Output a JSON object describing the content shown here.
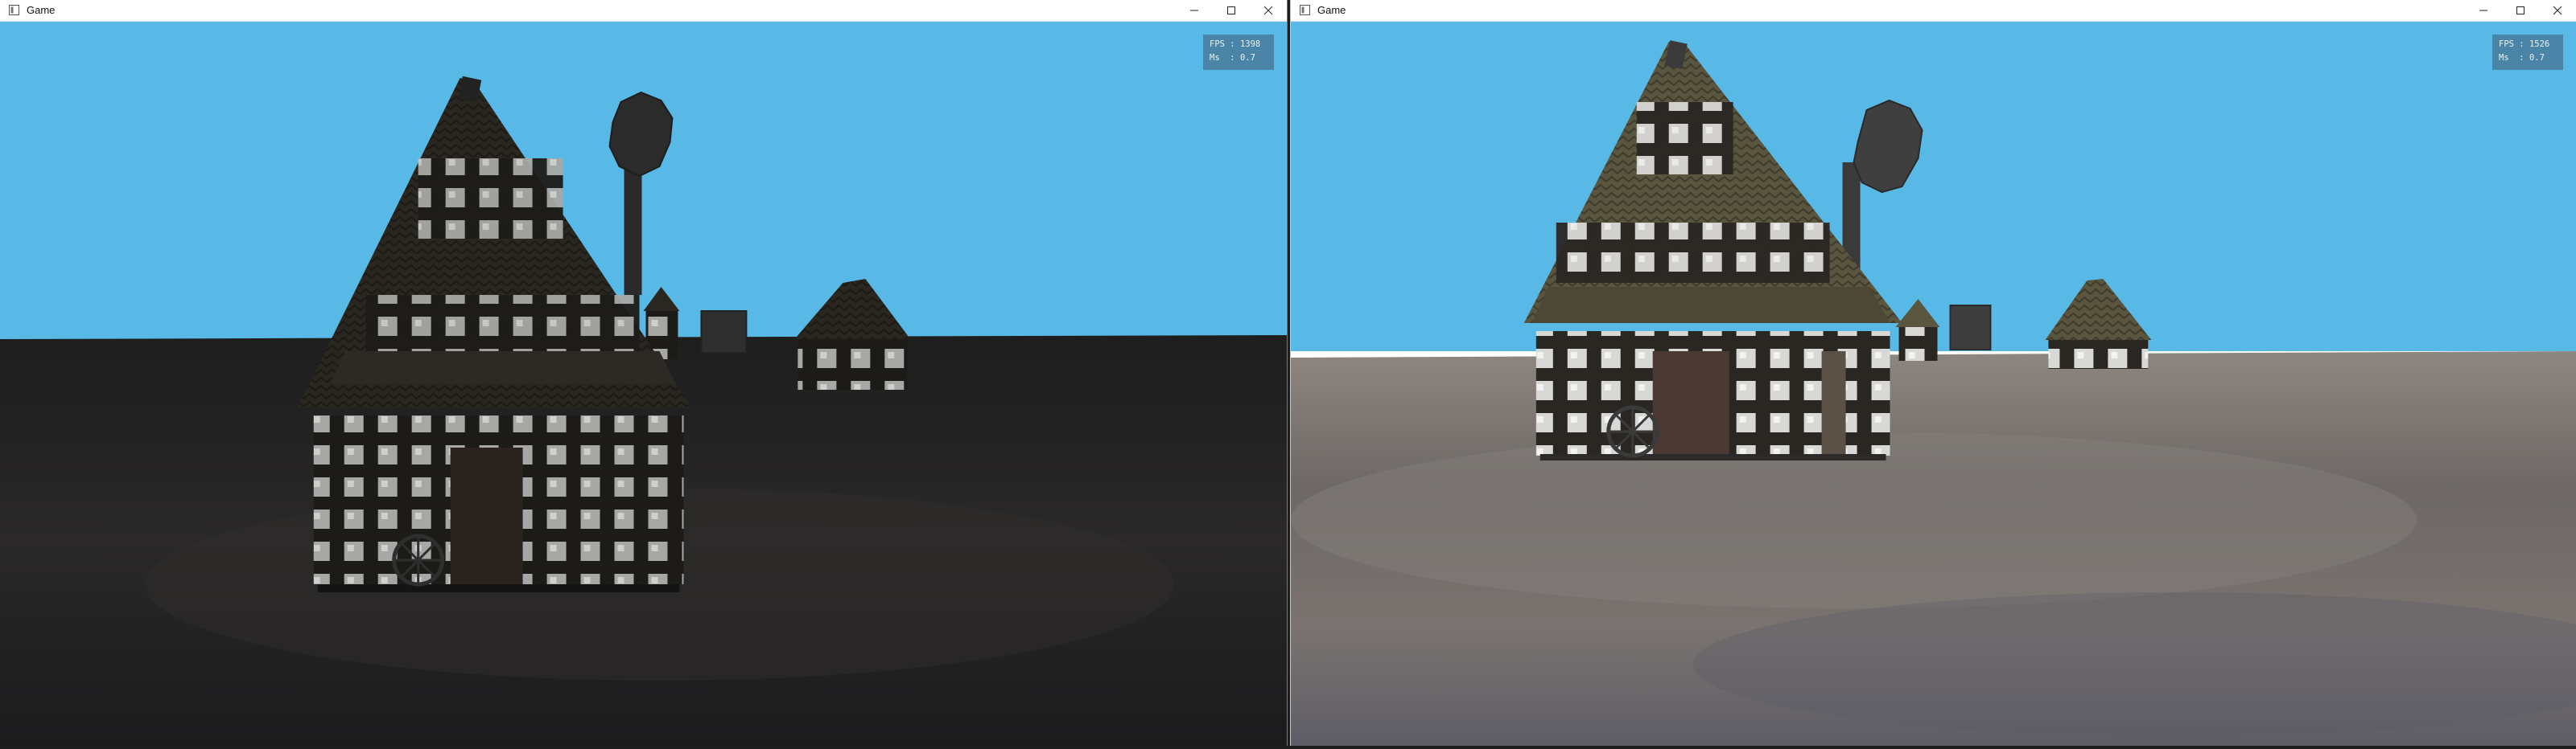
{
  "windows": [
    {
      "title": "Game",
      "stats": {
        "fps_label": "FPS",
        "fps_value": "1398",
        "ms_label": "Ms",
        "ms_value": "0.7"
      }
    },
    {
      "title": "Game",
      "stats": {
        "fps_label": "FPS",
        "fps_value": "1526",
        "ms_label": "Ms",
        "ms_value": "0.7"
      }
    }
  ],
  "colors": {
    "sky": "#58b9e6",
    "ground_dark": "#252525",
    "ground_lit": "#7a7370",
    "stats_panel": "#4a7894"
  },
  "icons": [
    "app-icon",
    "minimize-icon",
    "maximize-icon",
    "close-icon"
  ]
}
